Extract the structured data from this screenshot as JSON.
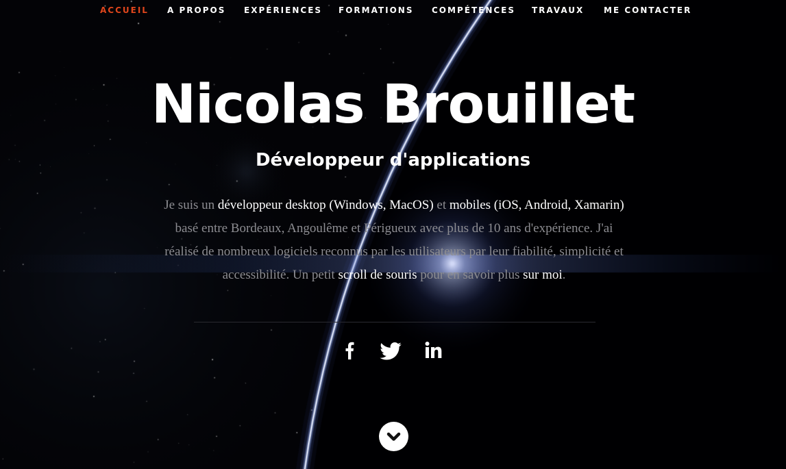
{
  "nav": {
    "items": [
      {
        "label": "ACCUEIL",
        "active": true
      },
      {
        "label": "A PROPOS",
        "active": false
      },
      {
        "label": "EXPÉRIENCES",
        "active": false
      },
      {
        "label": "FORMATIONS",
        "active": false
      },
      {
        "label": "COMPÉTENCES",
        "active": false
      },
      {
        "label": "TRAVAUX",
        "active": false
      },
      {
        "label": "ME CONTACTER",
        "active": false
      }
    ],
    "active_color": "#e0461c"
  },
  "hero": {
    "name": "Nicolas Brouillet",
    "subtitle": "Développeur d'applications",
    "intro": {
      "p1": "Je suis un ",
      "h1": "développeur desktop (Windows, MacOS)",
      "p2": " et ",
      "h2": "mobiles (iOS, Android, Xamarin)",
      "p3": " basé entre Bordeaux, Angoulême et Périgueux avec plus de 10 ans d'expérience. J'ai réalisé de nombreux logiciels reconnus par les utilisateurs par leur fiabilité, simplicité et accessibilité. Un petit ",
      "link1": "scroll de souris",
      "p4": " pour en savoir plus ",
      "link2": "sur moi",
      "p5": "."
    }
  },
  "social": {
    "icons": [
      "facebook-icon",
      "twitter-icon",
      "linkedin-icon"
    ]
  },
  "scroll_button": {
    "icon": "chevron-down-icon"
  }
}
